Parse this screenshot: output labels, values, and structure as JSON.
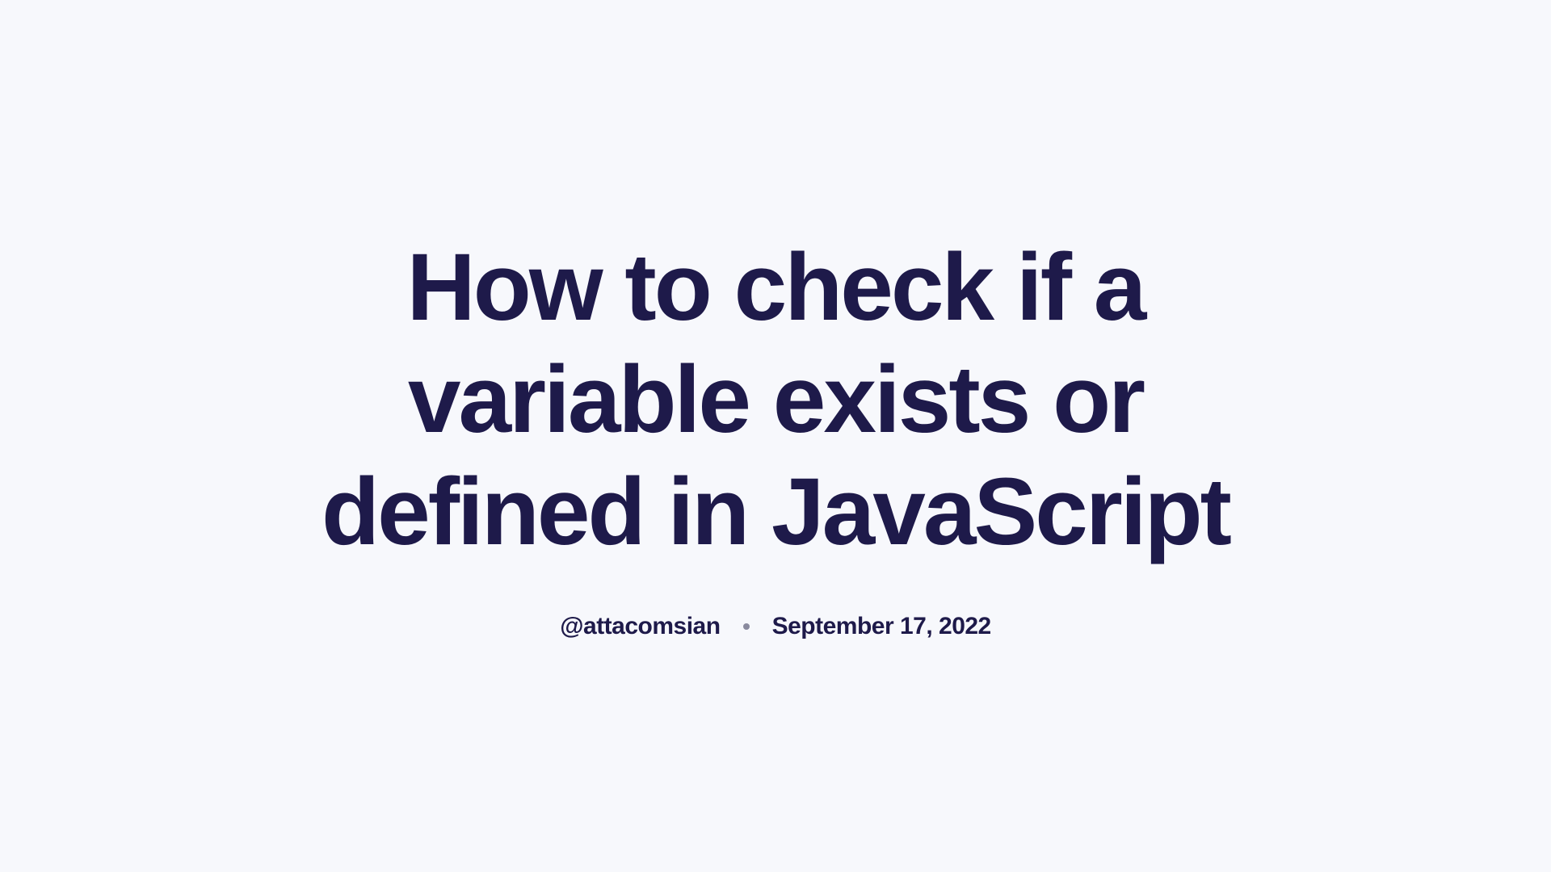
{
  "article": {
    "title": "How to check if a variable exists or defined in JavaScript",
    "author": "@attacomsian",
    "date": "September 17, 2022"
  }
}
